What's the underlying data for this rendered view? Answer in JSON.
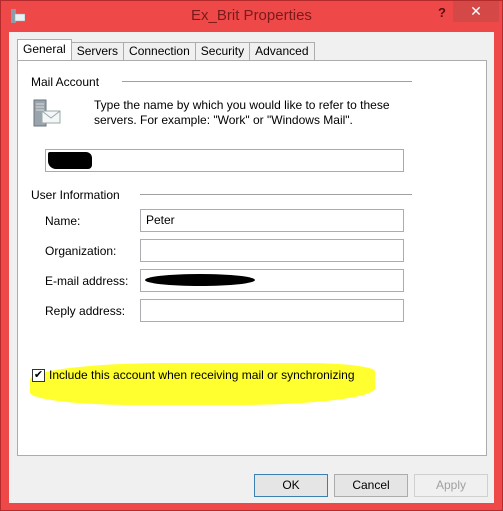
{
  "window": {
    "title": "Ex_Brit Properties",
    "help_label": "?",
    "close_label": "✕"
  },
  "tabs": [
    {
      "label": "General",
      "active": true
    },
    {
      "label": "Servers",
      "active": false
    },
    {
      "label": "Connection",
      "active": false
    },
    {
      "label": "Security",
      "active": false
    },
    {
      "label": "Advanced",
      "active": false
    }
  ],
  "mail_account": {
    "group_label": "Mail Account",
    "description": "Type the name by which you would like to refer to these servers.  For example: \"Work\" or \"Windows Mail\".",
    "account_name_value": "[redacted]"
  },
  "user_info": {
    "group_label": "User Information",
    "name_label": "Name:",
    "name_value": "Peter",
    "organization_label": "Organization:",
    "organization_value": "",
    "email_label": "E-mail address:",
    "email_value": "[redacted]",
    "reply_label": "Reply address:",
    "reply_value": ""
  },
  "include_checkbox": {
    "label": "Include this account when receiving mail or synchronizing",
    "checked": true,
    "check_glyph": "✔"
  },
  "buttons": {
    "ok": "OK",
    "cancel": "Cancel",
    "apply": "Apply"
  }
}
